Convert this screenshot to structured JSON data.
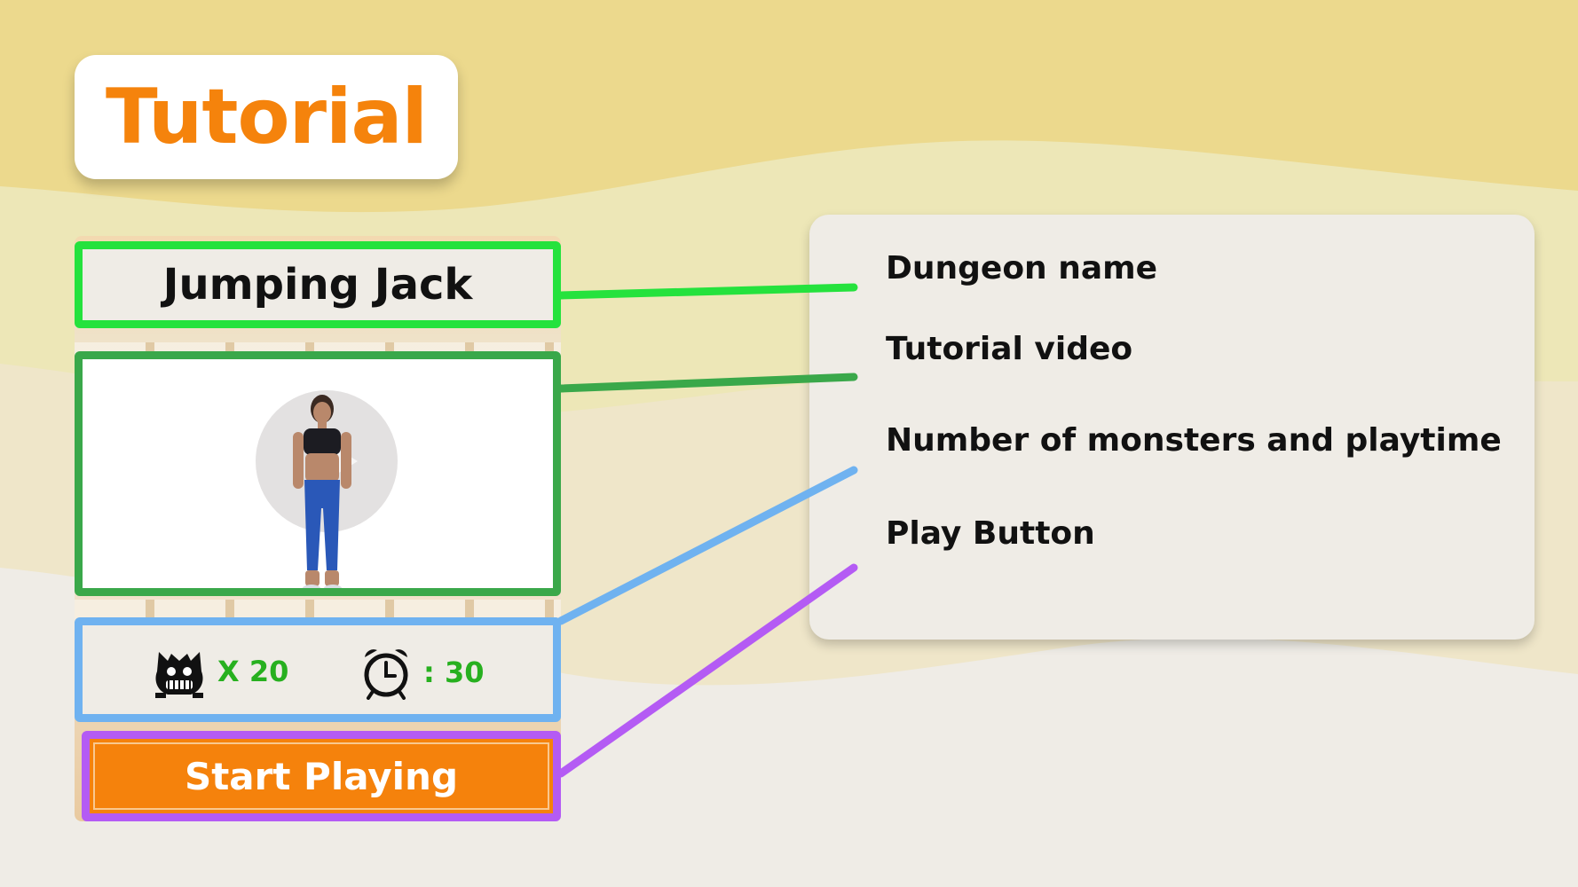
{
  "title": "Tutorial",
  "game_panel": {
    "dungeon_name": "Jumping Jack",
    "monsters": "X 20",
    "playtime": ": 30",
    "start_button": "Start Playing"
  },
  "legend": {
    "items": [
      {
        "label": "Dungeon name",
        "color": "#25e23d"
      },
      {
        "label": "Tutorial video",
        "color": "#3aa84a"
      },
      {
        "label": "Number of monsters and playtime",
        "color": "#6fb2f0"
      },
      {
        "label": "Play Button",
        "color": "#b45bf4"
      }
    ]
  },
  "colors": {
    "accent_orange": "#f5830c",
    "stat_green": "#27b01f",
    "background_top": "#ecd98d",
    "background_bottom": "#efece6"
  },
  "icons": {
    "monster": "monster-icon",
    "timer": "alarm-clock-icon",
    "play": "play-icon"
  }
}
